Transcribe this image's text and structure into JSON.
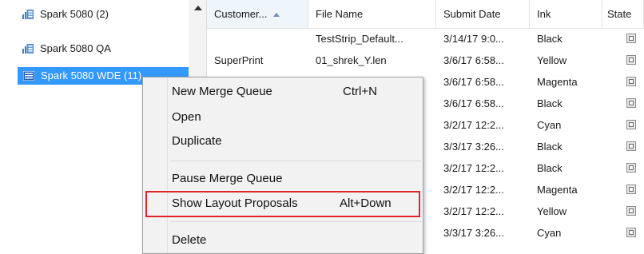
{
  "tree": {
    "items": [
      {
        "label": "Spark 5080 (2)"
      },
      {
        "label": "Spark 5080 QA"
      },
      {
        "label": "Spark 5080 WDE  (11)"
      }
    ]
  },
  "grid": {
    "columns": [
      "Customer...",
      "File Name",
      "Submit Date",
      "Ink",
      "State"
    ],
    "sorted_column": "Customer...",
    "sort_direction": "ascending",
    "rows": [
      {
        "customer": "",
        "file": "TestStrip_Default...",
        "date": "3/14/17 9:0...",
        "ink": "Black"
      },
      {
        "customer": "SuperPrint",
        "file": "01_shrek_Y.len",
        "date": "3/6/17 6:58...",
        "ink": "Yellow"
      },
      {
        "customer": "",
        "file": "",
        "date": "3/6/17 6:58...",
        "ink": "Magenta"
      },
      {
        "customer": "",
        "file": "",
        "date": "3/6/17 6:58...",
        "ink": "Black"
      },
      {
        "customer": "",
        "file": "..",
        "date": "3/2/17 12:2...",
        "ink": "Cyan"
      },
      {
        "customer": "",
        "file": "",
        "date": "3/3/17 3:26...",
        "ink": "Black"
      },
      {
        "customer": "",
        "file": "..",
        "date": "3/2/17 12:2...",
        "ink": "Black"
      },
      {
        "customer": "",
        "file": "..",
        "date": "3/2/17 12:2...",
        "ink": "Magenta"
      },
      {
        "customer": "",
        "file": "..",
        "date": "3/2/17 12:2...",
        "ink": "Yellow"
      },
      {
        "customer": "",
        "file": "",
        "date": "3/3/17 3:26...",
        "ink": "Cyan"
      }
    ]
  },
  "context_menu": {
    "new_merge_queue": "New Merge Queue",
    "new_merge_queue_shortcut": "Ctrl+N",
    "open": "Open",
    "duplicate": "Duplicate",
    "pause_merge_queue": "Pause Merge Queue",
    "show_layout_proposals": "Show Layout Proposals",
    "show_layout_proposals_shortcut": "Alt+Down",
    "delete": "Delete",
    "highlighted_item": "Show Layout Proposals"
  },
  "colors": {
    "selection": "#3399ff",
    "highlight_border": "#e0242a",
    "menu_background": "#f2f2f2"
  },
  "icons": {
    "queue": "printer-queue-icon",
    "state": "state-icon",
    "sort": "sort-ascending-icon"
  }
}
